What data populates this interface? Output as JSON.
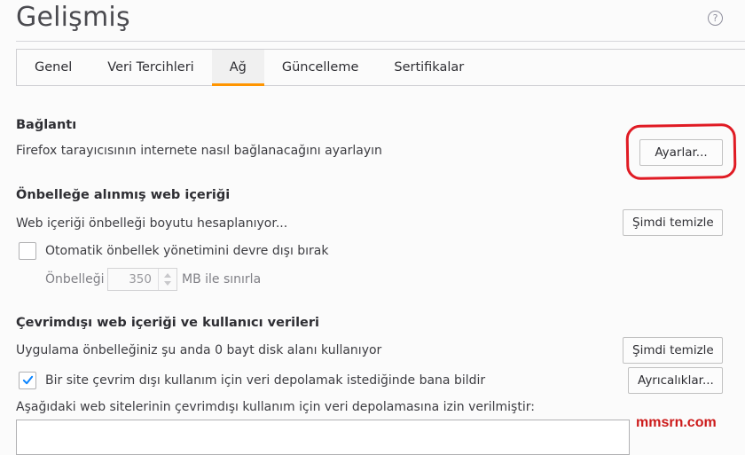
{
  "header": {
    "title": "Gelişmiş",
    "help_icon_glyph": "?"
  },
  "tabs": [
    {
      "label": "Genel",
      "active": false
    },
    {
      "label": "Veri Tercihleri",
      "active": false
    },
    {
      "label": "Ağ",
      "active": true
    },
    {
      "label": "Güncelleme",
      "active": false
    },
    {
      "label": "Sertifikalar",
      "active": false
    }
  ],
  "connection": {
    "title": "Bağlantı",
    "description": "Firefox tarayıcısının internete nasıl bağlanacağını ayarlayın",
    "settings_button": "Ayarlar..."
  },
  "cache": {
    "title": "Önbelleğe alınmış web içeriği",
    "description": "Web içeriği önbelleği boyutu hesaplanıyor...",
    "clear_button": "Şimdi temizle",
    "override_label": "Otomatik önbellek yönetimini devre dışı bırak",
    "override_checked": false,
    "limit_prefix": "Önbelleği",
    "limit_value": "350",
    "limit_suffix": "MB ile sınırla"
  },
  "offline": {
    "title": "Çevrimdışı web içeriği ve kullanıcı verileri",
    "description": "Uygulama önbelleğiniz şu anda 0 bayt disk alanı kullanıyor",
    "clear_button": "Şimdi temizle",
    "notify_label": "Bir site çevrim dışı kullanım için veri depolamak istediğinde bana bildir",
    "notify_checked": true,
    "exceptions_button": "Ayrıcalıklar...",
    "allowed_sites_label": "Aşağıdaki web sitelerinin çevrimdışı kullanım için veri depolamasına izin verilmiştir:"
  },
  "watermark": "mmsrn.com",
  "colors": {
    "accent": "#ff9500",
    "highlight": "#e01b24",
    "checkmark": "#0a84ff"
  }
}
